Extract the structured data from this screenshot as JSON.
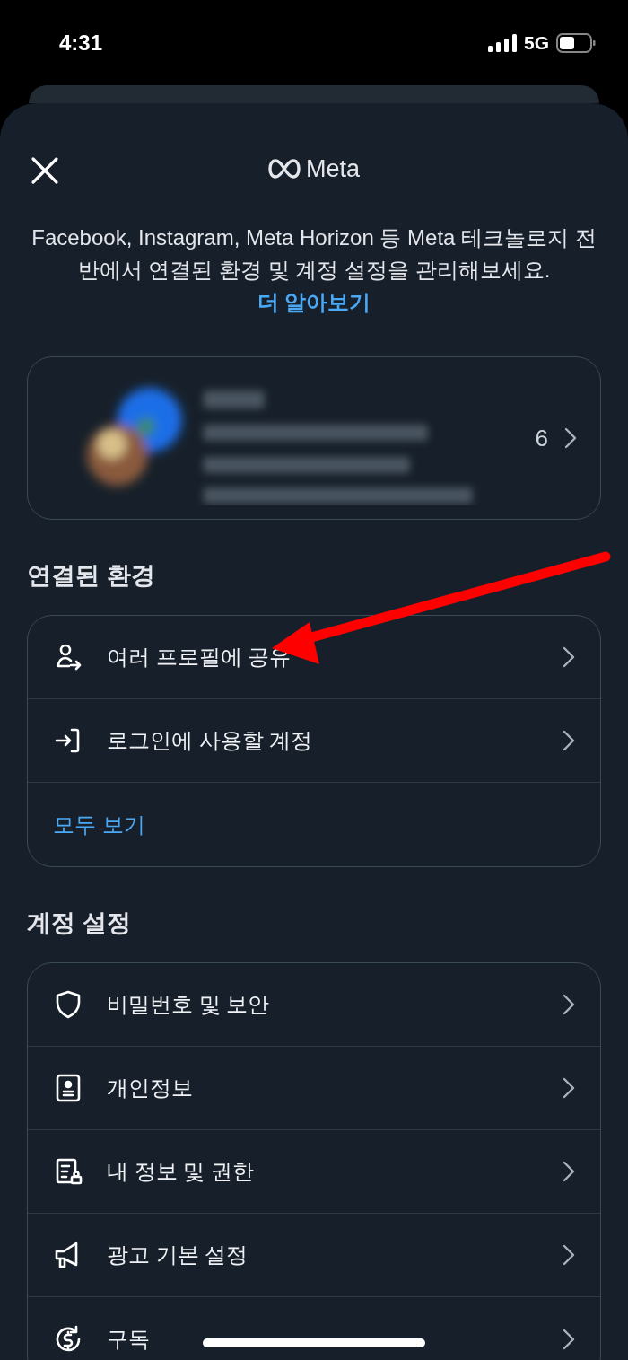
{
  "status_bar": {
    "time": "4:31",
    "network": "5G"
  },
  "header": {
    "title": "Meta"
  },
  "intro": {
    "text": "Facebook, Instagram, Meta Horizon 등 Meta 테크놀로지 전반에서 연결된 환경 및 계정 설정을 관리해보세요.",
    "link": "더 알아보기"
  },
  "profile_card": {
    "count": "6"
  },
  "sections": [
    {
      "title": "연결된 환경",
      "items": [
        {
          "label": "여러 프로필에 공유"
        },
        {
          "label": "로그인에 사용할 계정"
        }
      ],
      "see_all": "모두 보기"
    },
    {
      "title": "계정 설정",
      "items": [
        {
          "label": "비밀번호 및 보안"
        },
        {
          "label": "개인정보"
        },
        {
          "label": "내 정보 및 권한"
        },
        {
          "label": "광고 기본 설정"
        },
        {
          "label": "구독"
        }
      ]
    }
  ]
}
